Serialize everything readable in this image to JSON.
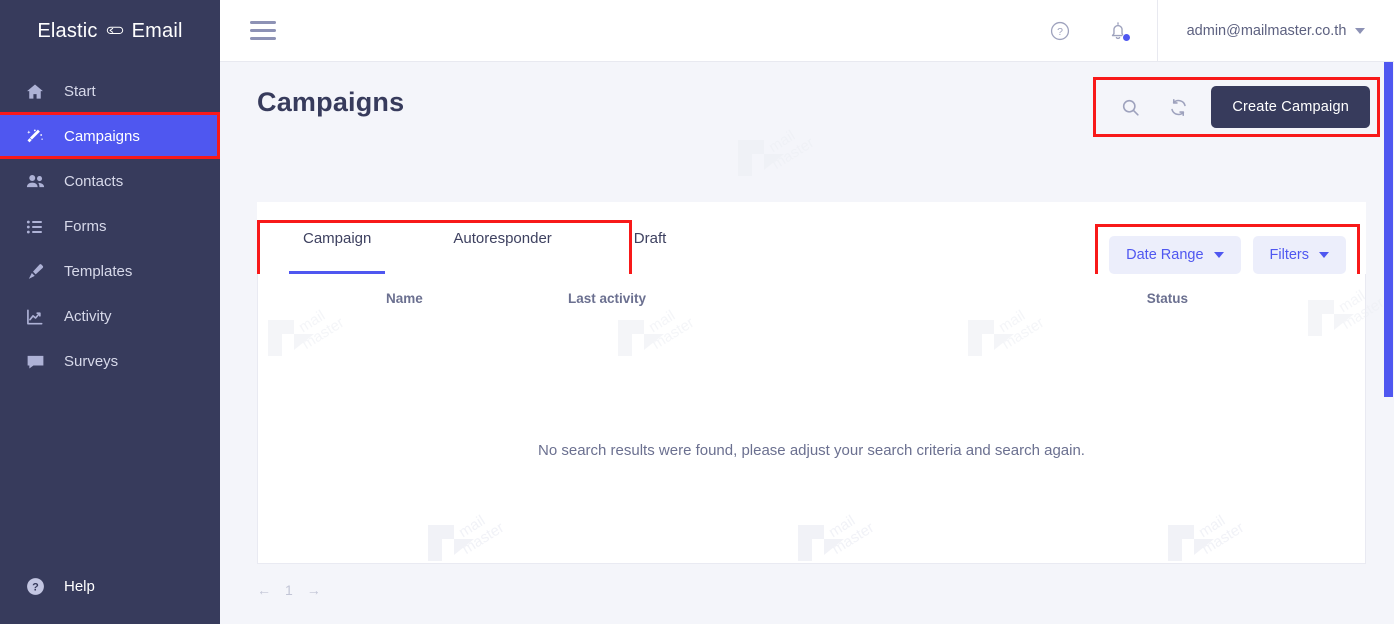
{
  "sidebar": {
    "logo": {
      "left": "Elastic",
      "right": "Email",
      "icon": "loop-icon"
    },
    "items": [
      {
        "label": "Start",
        "icon": "home-icon",
        "active": false
      },
      {
        "label": "Campaigns",
        "icon": "magic-wand-icon",
        "active": true
      },
      {
        "label": "Contacts",
        "icon": "people-icon",
        "active": false
      },
      {
        "label": "Forms",
        "icon": "list-icon",
        "active": false
      },
      {
        "label": "Templates",
        "icon": "paintbrush-icon",
        "active": false
      },
      {
        "label": "Activity",
        "icon": "chart-line-icon",
        "active": false
      },
      {
        "label": "Surveys",
        "icon": "chat-bubble-icon",
        "active": false
      }
    ],
    "help": {
      "label": "Help",
      "icon": "question-circle-icon"
    }
  },
  "topbar": {
    "menu_icon": "hamburger-icon",
    "help_icon": "help-circle-icon",
    "notifications_icon": "bell-icon",
    "user_email": "admin@mailmaster.co.th",
    "user_caret": "chevron-down-icon"
  },
  "page": {
    "title": "Campaigns"
  },
  "head_actions": {
    "search_icon": "search-icon",
    "refresh_icon": "refresh-icon",
    "create_label": "Create Campaign"
  },
  "tabs": [
    {
      "label": "Campaign",
      "active": true
    },
    {
      "label": "Autoresponder",
      "active": false
    },
    {
      "label": "Draft",
      "active": false
    }
  ],
  "filters": {
    "date_range_label": "Date Range",
    "filters_label": "Filters"
  },
  "table": {
    "columns": [
      "Name",
      "Last activity",
      "Status"
    ],
    "rows": [],
    "empty_message": "No search results were found, please adjust your search criteria and search again."
  },
  "pagination": {
    "prev": "←",
    "page": "1",
    "next": "→"
  },
  "watermark": {
    "line1": "mail",
    "line2": "master"
  },
  "colors": {
    "sidebar_bg": "#373b5c",
    "accent": "#4f57f0",
    "page_bg": "#f4f5fa",
    "annotation": "#f81919",
    "primary_btn": "#373b5c",
    "soft_btn_bg": "#eceefb"
  }
}
